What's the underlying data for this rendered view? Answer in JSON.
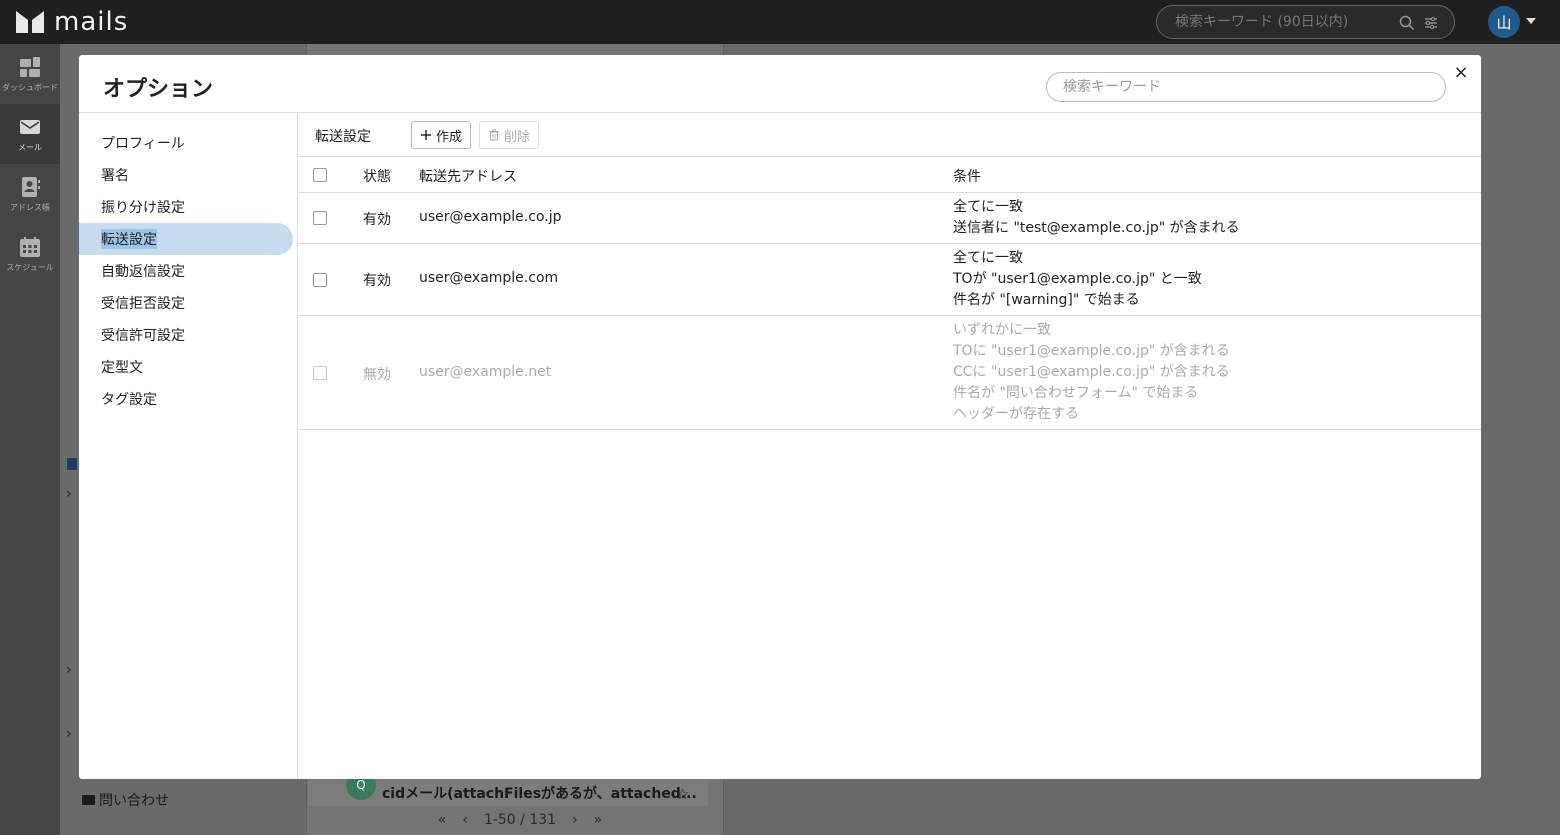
{
  "app": {
    "name": "mails"
  },
  "topbar": {
    "search_placeholder": "検索キーワード (90日以内)",
    "avatar_initial": "山"
  },
  "rail": {
    "items": [
      {
        "label": "ダッシュボード",
        "icon": "dashboard-icon"
      },
      {
        "label": "メール",
        "icon": "mail-icon"
      },
      {
        "label": "アドレス帳",
        "icon": "address-book-icon"
      },
      {
        "label": "スケジュール",
        "icon": "calendar-icon"
      }
    ]
  },
  "background": {
    "folder_label": "問い合わせ",
    "list_row_subject": "cidメール(attachFilesがあるが、attached...",
    "list_row_avatar": "Q",
    "pager_text": "1-50 / 131"
  },
  "modal": {
    "title": "オプション",
    "search_placeholder": "検索キーワード",
    "close_label": "×",
    "menu": [
      {
        "label": "プロフィール"
      },
      {
        "label": "署名"
      },
      {
        "label": "振り分け設定"
      },
      {
        "label": "転送設定",
        "active": true
      },
      {
        "label": "自動返信設定"
      },
      {
        "label": "受信拒否設定"
      },
      {
        "label": "受信許可設定"
      },
      {
        "label": "定型文"
      },
      {
        "label": "タグ設定"
      }
    ],
    "section": {
      "title": "転送設定",
      "create_label": "作成",
      "delete_label": "削除",
      "columns": {
        "status": "状態",
        "address": "転送先アドレス",
        "conditions": "条件"
      },
      "rows": [
        {
          "status": "有効",
          "address": "user@example.co.jp",
          "conditions": [
            "全てに一致",
            "送信者に \"test@example.co.jp\" が含まれる"
          ]
        },
        {
          "status": "有効",
          "address": "user@example.com",
          "conditions": [
            "全てに一致",
            "TOが \"user1@example.co.jp\" と一致",
            "件名が \"[warning]\" で始まる"
          ]
        },
        {
          "status": "無効",
          "address": "user@example.net",
          "conditions": [
            "いずれかに一致",
            "TOに \"user1@example.co.jp\" が含まれる",
            "CCに \"user1@example.co.jp\" が含まれる",
            "件名が \"問い合わせフォーム\" で始まる",
            "ヘッダーが存在する"
          ]
        }
      ]
    }
  }
}
